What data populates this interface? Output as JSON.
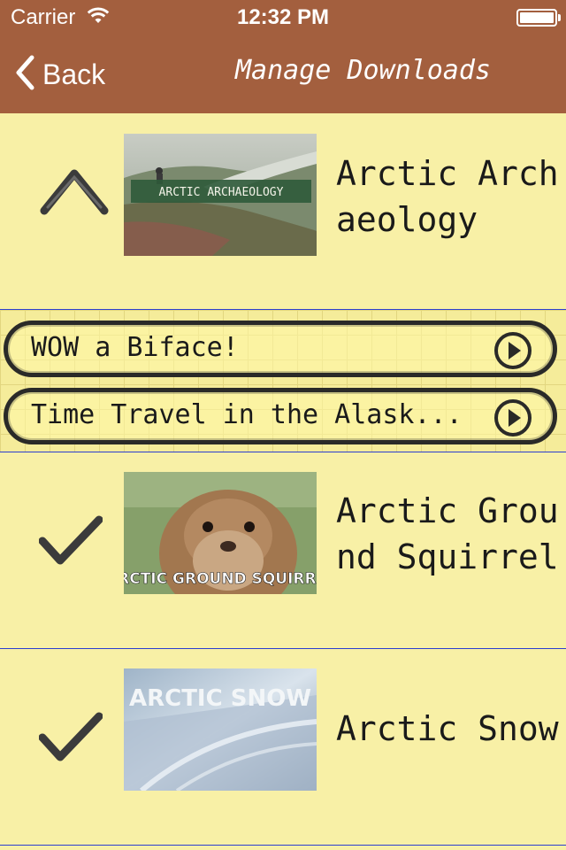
{
  "status_bar": {
    "carrier": "Carrier",
    "time": "12:32 PM"
  },
  "navbar": {
    "back_label": "Back",
    "title": "Manage Downloads"
  },
  "collections": [
    {
      "title": "Arctic Archaeology",
      "thumb_caption": "ARCTIC ARCHAEOLOGY",
      "state": "expanded"
    },
    {
      "title": "Arctic Ground Squirrel",
      "thumb_caption": "ARCTIC GROUND SQUIRREL",
      "state": "downloaded"
    },
    {
      "title": "Arctic Snow",
      "thumb_caption": "ARCTIC SNOW",
      "state": "downloaded"
    }
  ],
  "episodes": [
    {
      "title": "WOW a Biface!"
    },
    {
      "title": "Time Travel in the Alask..."
    }
  ],
  "colors": {
    "navbar": "#a35f3e",
    "background": "#f8f0a6",
    "separator": "#2c3fd0",
    "ink": "#1a1a1a"
  }
}
